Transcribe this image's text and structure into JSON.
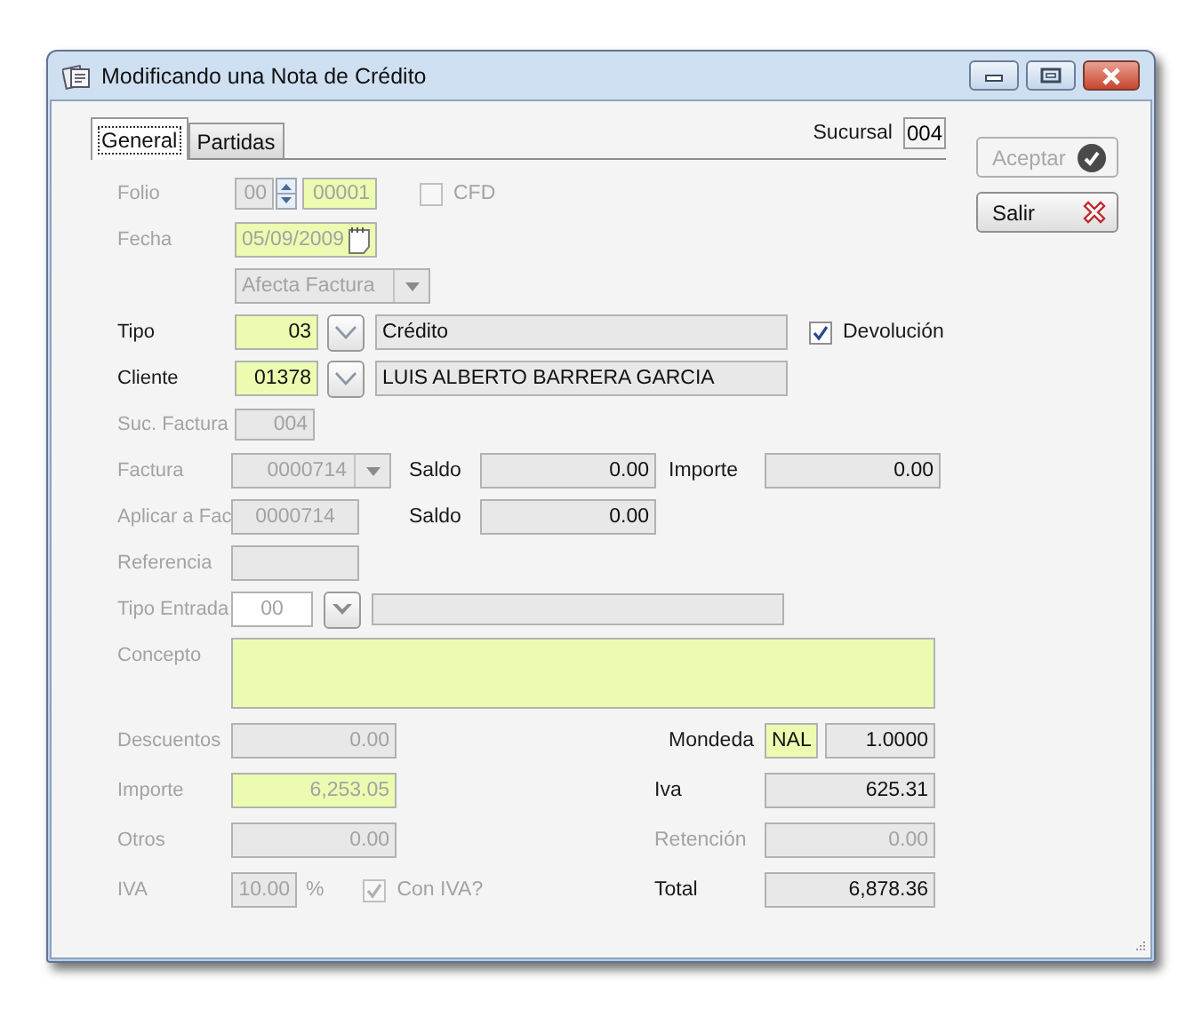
{
  "window": {
    "title": "Modificando una Nota de Crédito"
  },
  "tabs": [
    {
      "label": "General",
      "selected": true
    },
    {
      "label": "Partidas",
      "selected": false
    }
  ],
  "sucursal": {
    "label": "Sucursal",
    "value": "004"
  },
  "buttons": [
    {
      "label": "Aceptar",
      "kind": "accept",
      "disabled": true
    },
    {
      "label": "Salir",
      "kind": "exit",
      "disabled": false
    }
  ],
  "folio": {
    "label": {
      "text": "Folio",
      "disabled": true
    },
    "series": {
      "value": "00",
      "kind": "readonly",
      "disabled": true
    },
    "number": {
      "value": "00001",
      "kind": "required",
      "disabled": true
    }
  },
  "cfd": {
    "label": "CFD",
    "checked": false,
    "disabled": true
  },
  "fecha": {
    "label": {
      "text": "Fecha",
      "disabled": true
    },
    "date": {
      "value": "05/09/2009",
      "kind": "required",
      "disabled": true
    }
  },
  "afecta_factura": {
    "value": "Afecta Factura",
    "kind": "readonly",
    "disabled": true
  },
  "tipo": {
    "label": {
      "text": "Tipo",
      "disabled": false
    },
    "code": {
      "value": "03",
      "kind": "required",
      "disabled": false
    },
    "description": {
      "value": "Crédito",
      "kind": "readonly",
      "disabled": false
    }
  },
  "devolucion": {
    "label": "Devolución",
    "checked": true,
    "disabled": false
  },
  "cliente": {
    "label": {
      "text": "Cliente",
      "disabled": false
    },
    "code": {
      "value": "01378",
      "kind": "required",
      "disabled": false
    },
    "name": {
      "value": "LUIS ALBERTO BARRERA GARCIA",
      "kind": "readonly",
      "disabled": false
    }
  },
  "suc_factura": {
    "label": {
      "text": "Suc. Factura",
      "disabled": true
    },
    "field": {
      "value": "004",
      "kind": "readonly",
      "disabled": true
    }
  },
  "factura": {
    "label": {
      "text": "Factura",
      "disabled": true
    },
    "number": {
      "value": "0000714",
      "kind": "readonly",
      "disabled": true
    },
    "saldo_label": {
      "text": "Saldo",
      "disabled": false
    },
    "saldo": {
      "value": "0.00",
      "kind": "readonly",
      "disabled": false
    },
    "importe_label": {
      "text": "Importe",
      "disabled": false
    },
    "importe": {
      "value": "0.00",
      "kind": "readonly",
      "disabled": false
    }
  },
  "aplicar_a_factura": {
    "label": {
      "text": "Aplicar a Fac",
      "disabled": true
    },
    "number": {
      "value": "0000714",
      "kind": "readonly",
      "disabled": true
    },
    "saldo_label": {
      "text": "Saldo",
      "disabled": false
    },
    "saldo": {
      "value": "0.00",
      "kind": "readonly",
      "disabled": false
    }
  },
  "referencia": {
    "label": {
      "text": "Referencia",
      "disabled": true
    },
    "field": {
      "kind": "readonly"
    }
  },
  "tipo_entrada": {
    "label": {
      "text": "Tipo Entrada",
      "disabled": true
    },
    "code": {
      "value": "00",
      "kind": "editable",
      "disabled": true
    },
    "description": {
      "kind": "readonly"
    }
  },
  "concepto": {
    "label": {
      "text": "Concepto",
      "disabled": true
    },
    "field": {
      "kind": "required"
    }
  },
  "descuentos": {
    "label": {
      "text": "Descuentos",
      "disabled": true
    },
    "field": {
      "value": "0.00",
      "kind": "readonly",
      "disabled": true
    }
  },
  "importe": {
    "label": {
      "text": "Importe",
      "disabled": true
    },
    "field": {
      "value": "6,253.05",
      "kind": "required",
      "disabled": true
    }
  },
  "otros": {
    "label": {
      "text": "Otros",
      "disabled": true
    },
    "field": {
      "value": "0.00",
      "kind": "readonly",
      "disabled": true
    }
  },
  "iva_rate": {
    "label": {
      "text": "IVA",
      "disabled": true
    },
    "field": {
      "value": "10.00",
      "kind": "readonly",
      "disabled": true
    },
    "unit": "%"
  },
  "con_iva": {
    "label": "Con IVA?",
    "checked": true,
    "disabled": true
  },
  "moneda": {
    "label": {
      "text": "Mondeda",
      "disabled": false
    },
    "code": {
      "value": "NAL",
      "kind": "required",
      "disabled": false
    },
    "rate": {
      "value": "1.0000",
      "kind": "readonly",
      "disabled": false
    }
  },
  "iva": {
    "label": {
      "text": "Iva",
      "disabled": false
    },
    "field": {
      "value": "625.31",
      "kind": "readonly",
      "disabled": false
    }
  },
  "retencion": {
    "label": {
      "text": "Retención",
      "disabled": true
    },
    "field": {
      "value": "0.00",
      "kind": "readonly",
      "disabled": true
    }
  },
  "total": {
    "label": {
      "text": "Total",
      "disabled": false
    },
    "field": {
      "value": "6,878.36",
      "kind": "readonly",
      "disabled": false
    }
  }
}
